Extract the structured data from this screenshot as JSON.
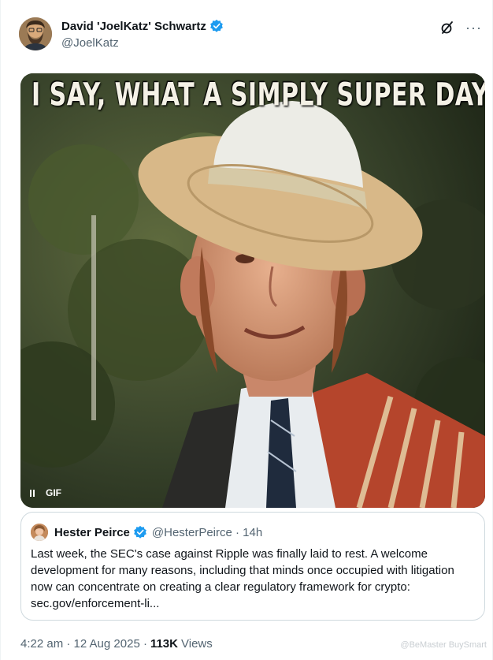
{
  "author": {
    "display_name": "David 'JoelKatz' Schwartz",
    "handle": "@JoelKatz",
    "avatar_icon": "avatar-bearded-man",
    "verified_color": "#1d9bf0"
  },
  "header_actions": {
    "grok_icon": "grok-icon",
    "more_icon": "more-icon",
    "more_label": "···"
  },
  "media": {
    "caption": "I SAY, WHAT A SIMPLY SUPER DAY!",
    "badge": "GIF",
    "pause_icon": "pause-icon"
  },
  "quoted_tweet": {
    "display_name": "Hester Peirce",
    "handle_time": "@HesterPeirce · 14h",
    "text": "Last week, the SEC's case against Ripple was finally laid to rest. A welcome development for many reasons, including that minds once occupied with litigation now can concentrate on creating a clear regulatory framework for crypto: sec.gov/enforcement-li..."
  },
  "meta": {
    "timestamp": "4:22 am · 12 Aug 2025 ·",
    "views_count": "113K",
    "views_label": "Views"
  },
  "watermark": {
    "text": "@BeMaster BuySmart"
  }
}
